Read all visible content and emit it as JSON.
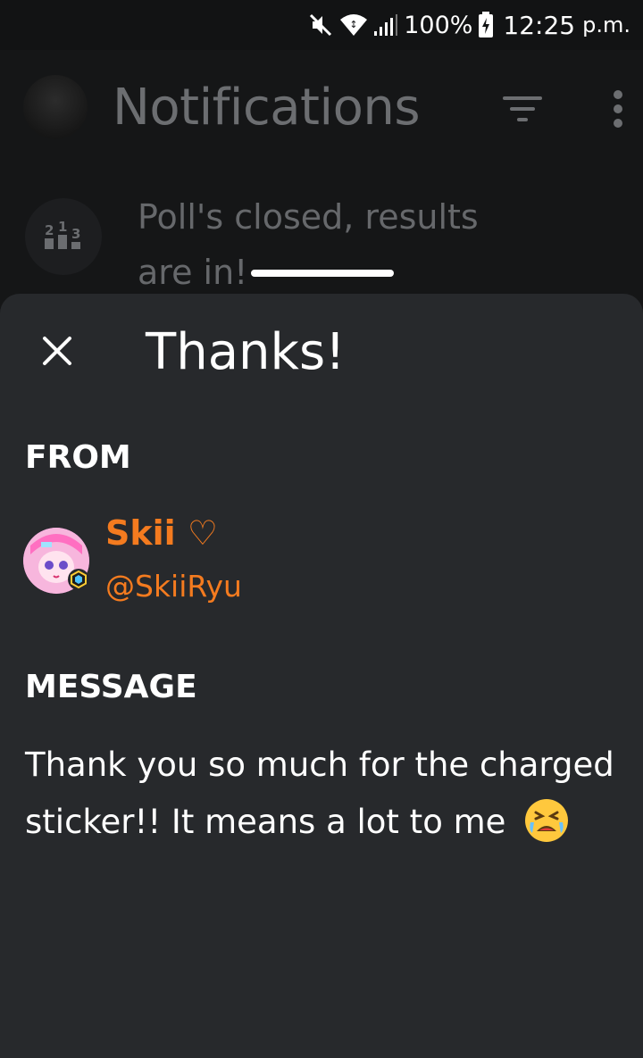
{
  "status_bar": {
    "battery": "100%",
    "time": "12:25",
    "ampm": "p.m."
  },
  "background": {
    "header_title": "Notifications",
    "notification_icon_text": "2₁3",
    "notification_text": "Poll's closed, results are in!"
  },
  "sheet": {
    "title": "Thanks!",
    "from_label": "FROM",
    "sender_name": "Skii ♡",
    "sender_handle": "@SkiiRyu",
    "message_label": "MESSAGE",
    "message": "Thank you so much for the charged sticker!! It means a lot to me"
  },
  "colors": {
    "accent": "#f47b1f",
    "sheet_bg": "#27292c",
    "background_text": "#6c6e71"
  },
  "icons": {
    "mute": "mute-icon",
    "wifi": "wifi-icon",
    "signal": "signal-icon",
    "battery": "battery-charging-icon",
    "filter": "filter-icon",
    "more": "more-vert-icon",
    "close": "close-icon",
    "emoji": "crying-face-emoji"
  }
}
